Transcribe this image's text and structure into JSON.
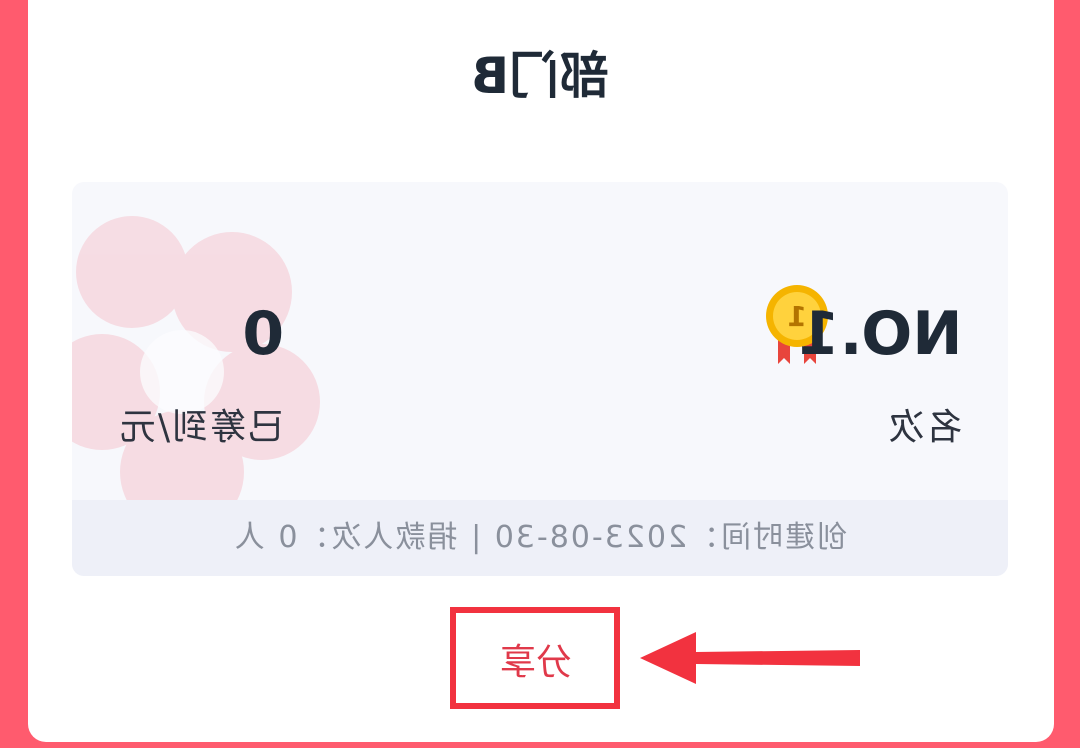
{
  "header": {
    "title": "部门B"
  },
  "stats": {
    "rank_value": "NO.1",
    "rank_label": "名次",
    "amount_value": "0",
    "amount_label": "已筹到/元",
    "medal_number": "1"
  },
  "info": {
    "text": "创建时间：2023-08-30 | 捐款人次：0 人"
  },
  "actions": {
    "share_label": "分享"
  },
  "colors": {
    "background": "#ff5b6e",
    "accent": "#f2323f",
    "medal": "#f5b400"
  }
}
